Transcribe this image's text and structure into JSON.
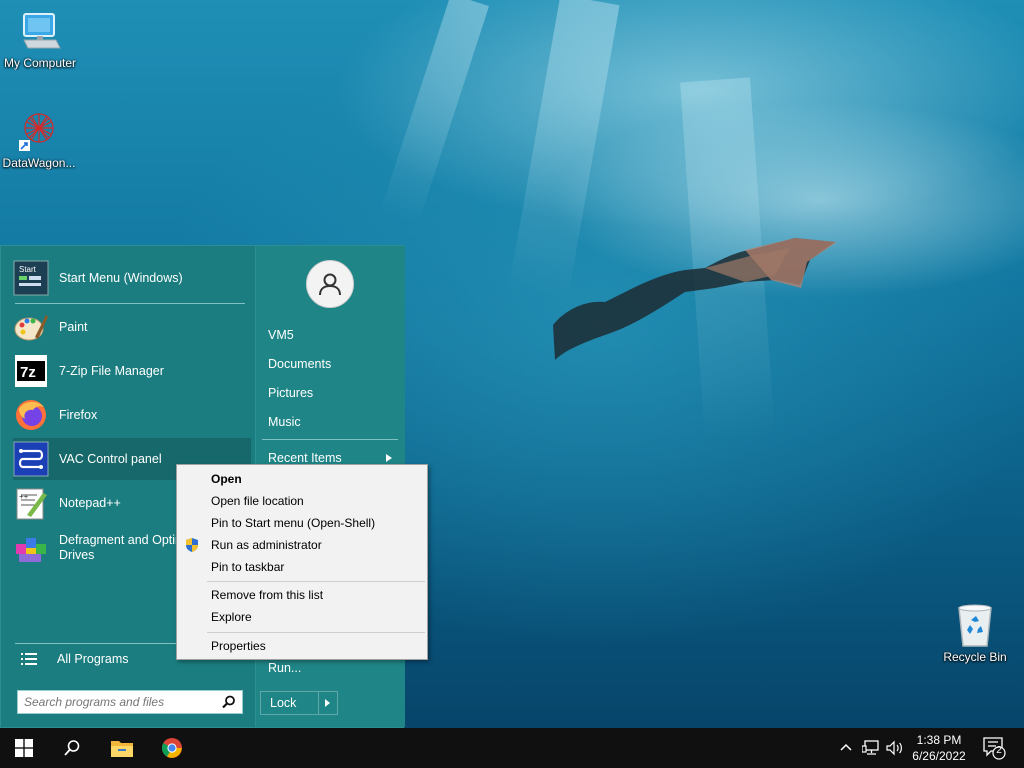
{
  "desktop": {
    "icons": [
      {
        "label": "My Computer",
        "icon": "monitor-icon"
      },
      {
        "label": "DataWagon...",
        "icon": "datawagon-icon"
      },
      {
        "label": "Recycle Bin",
        "icon": "recycle-bin-icon"
      }
    ]
  },
  "start_menu": {
    "pinned": [
      {
        "label": "Start Menu (Windows)",
        "icon": "start-menu-icon"
      }
    ],
    "recent": [
      {
        "label": "Paint",
        "icon": "paint-icon"
      },
      {
        "label": "7-Zip File Manager",
        "icon": "7zip-icon"
      },
      {
        "label": "Firefox",
        "icon": "firefox-icon"
      },
      {
        "label": "VAC Control panel",
        "icon": "vac-icon"
      },
      {
        "label": "Notepad++",
        "icon": "notepadpp-icon"
      },
      {
        "label": "Defragment and Optimize",
        "label2": "Drives",
        "icon": "defrag-icon"
      }
    ],
    "all_programs": "All Programs",
    "search_placeholder": "Search programs and files",
    "right": {
      "user": "VM5",
      "links": [
        "Documents",
        "Pictures",
        "Music"
      ],
      "recent_items": "Recent Items",
      "run": "Run...",
      "lock": "Lock"
    }
  },
  "context_menu": {
    "items": [
      "Open",
      "Open file location",
      "Pin to Start menu (Open-Shell)",
      "Run as administrator",
      "Pin to taskbar"
    ],
    "items2": [
      "Remove from this list",
      "Explore"
    ],
    "items3": [
      "Properties"
    ]
  },
  "taskbar": {
    "time": "1:38 PM",
    "date": "6/26/2022",
    "notification_count": "2"
  },
  "colors": {
    "start_menu_bg": "#1b7d7f",
    "selected_item": "#17686a",
    "taskbar": "#101010"
  }
}
